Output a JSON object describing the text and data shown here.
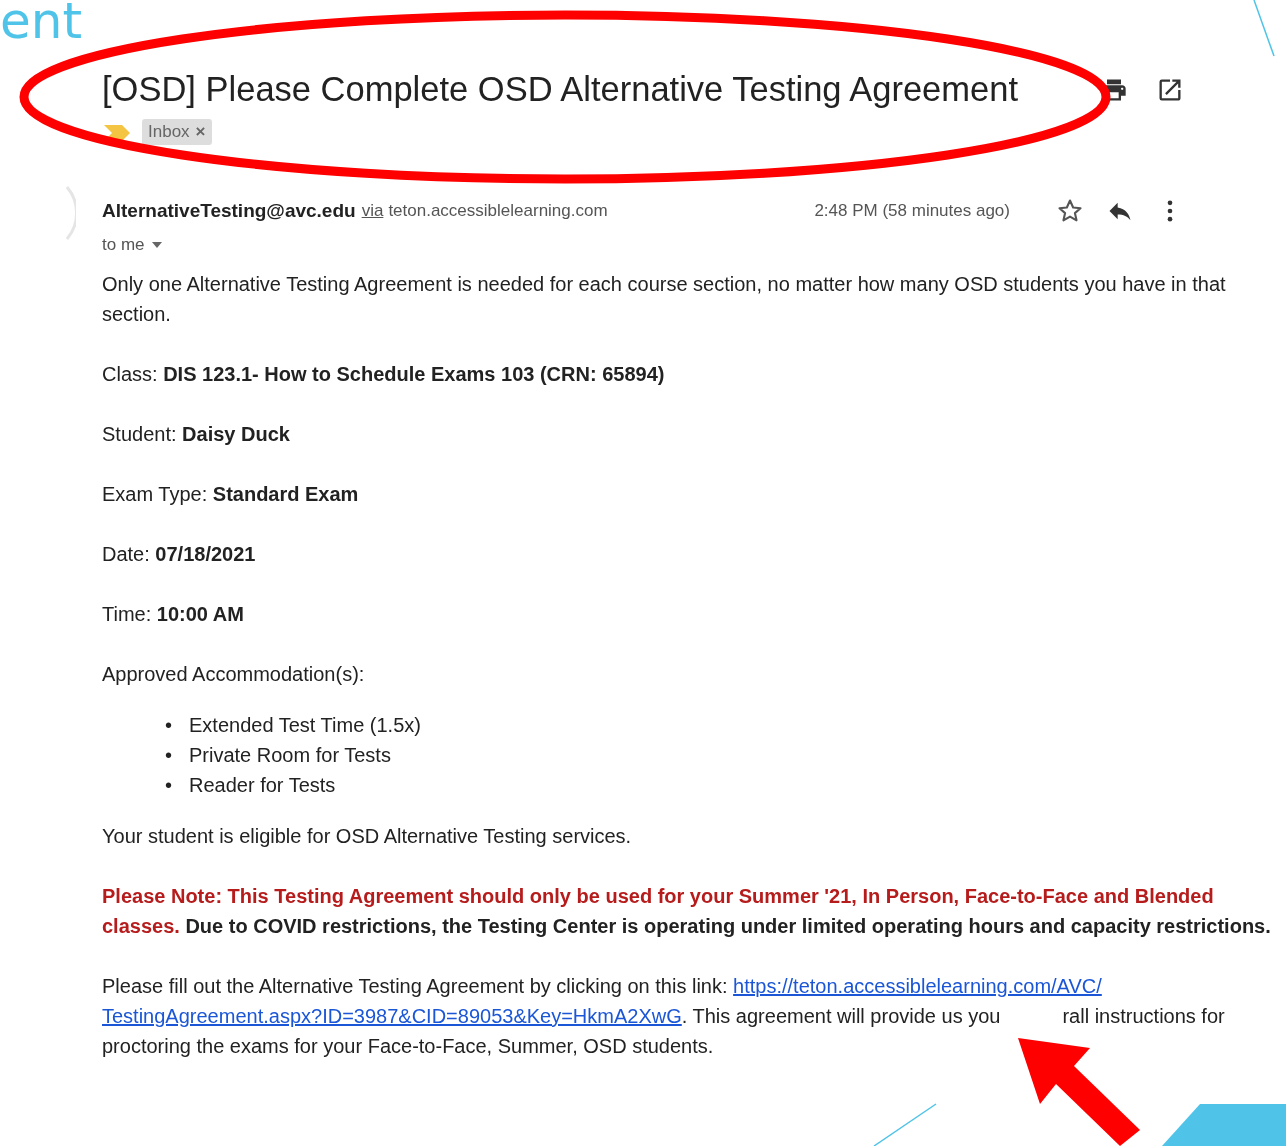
{
  "slide": {
    "title_fragment": "ent"
  },
  "email": {
    "subject": "[OSD] Please Complete OSD Alternative Testing Agreement",
    "labels": [
      {
        "name": "Inbox",
        "remove": "×"
      }
    ],
    "sender": {
      "address": "AlternativeTesting@avc.edu",
      "via": "via",
      "domain": "teton.accessiblelearning.com",
      "time": "2:48 PM (58 minutes ago)",
      "recipient": "to me",
      "starred": false
    },
    "intro": "Only one Alternative Testing Agreement is needed for each course section, no matter how many OSD students you have in that section.",
    "fields": [
      {
        "text": "Class: **DIS 123.1- How to Schedule Exams 103 (CRN: 65894)**"
      },
      {
        "text": "Student: **Daisy Duck**"
      },
      {
        "text": "Exam Type: **Standard Exam**"
      },
      {
        "text": "Date: **07/18/2021**"
      },
      {
        "text": "Time: **10:00 AM**"
      }
    ],
    "accommodations_heading": "Approved Accommodation(s):",
    "accommodations": [
      {
        "bullet": "•",
        "text": "Extended Test Time (1.5x)"
      },
      {
        "bullet": "•",
        "text": "Private Room for Tests"
      },
      {
        "bullet": "•",
        "text": "Reader for Tests"
      }
    ],
    "eligibility": "Your student is eligible for OSD Alternative Testing services.",
    "note": {
      "highlight": "Please Note: This Testing Agreement should only be used for your Summer '21, In Person, Face-to-Face and Blended classes.",
      "rest": "Due to COVID restrictions, the Testing Center is operating under limited operating hours and capacity restrictions."
    },
    "instructions": {
      "lead": "Please fill out the Alternative Testing Agreement by clicking on this link:",
      "link_lines": [
        "https://teton.accessiblelearning.com/AVC/",
        "TestingAgreement.aspx?ID=3987&CID=89053&Key=HkmA2XwG"
      ],
      "after_link": ". This agreement will provide us you",
      "after_arrow": "rall instructions for",
      "last_line": "proctoring the exams for your Face-to-Face, Summer, OSD students."
    }
  }
}
